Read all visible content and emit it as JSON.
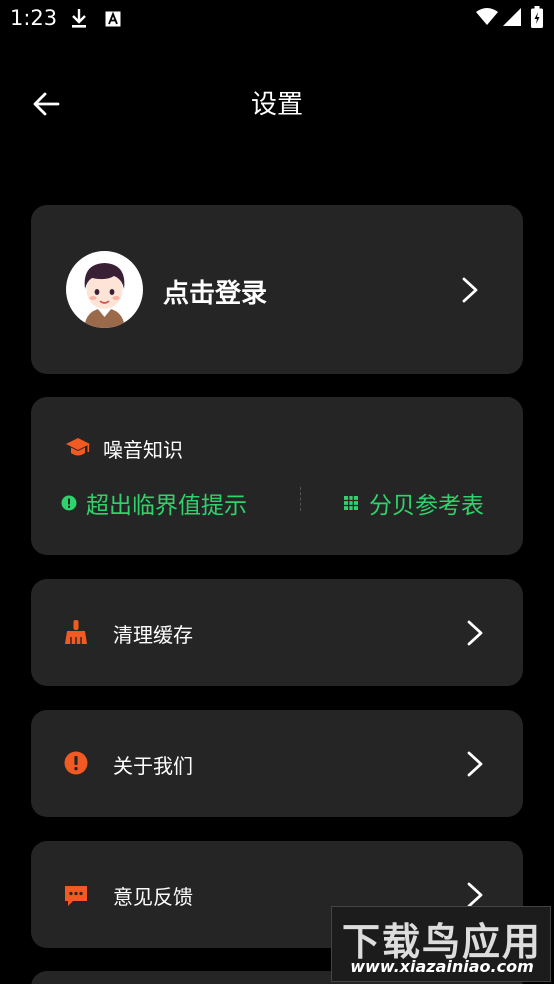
{
  "status_bar": {
    "time": "1:23",
    "left_icons": [
      "download-icon",
      "font-badge-icon"
    ],
    "right_icons": [
      "wifi-icon",
      "signal-icon",
      "battery-icon"
    ]
  },
  "header": {
    "title": "设置",
    "back_icon": "arrow-left-icon"
  },
  "profile": {
    "login_label": "点击登录",
    "avatar": "boy-avatar"
  },
  "noise_knowledge": {
    "title": "噪音知识",
    "title_icon": "graduation-cap-icon",
    "links": [
      {
        "label": "超出临界值提示",
        "icon": "alert-circle-icon"
      },
      {
        "label": "分贝参考表",
        "icon": "table-icon"
      }
    ]
  },
  "settings_rows": [
    {
      "label": "清理缓存",
      "icon": "broom-icon"
    },
    {
      "label": "关于我们",
      "icon": "exclamation-circle-icon"
    },
    {
      "label": "意见反馈",
      "icon": "chat-bubble-icon"
    }
  ],
  "colors": {
    "background": "#000000",
    "card": "#252525",
    "accent_orange": "#f15a22",
    "accent_green": "#2ed36b",
    "text": "#ffffff"
  },
  "watermark": {
    "main": "下载鸟应用",
    "url": "www.xiazainiao.com"
  }
}
